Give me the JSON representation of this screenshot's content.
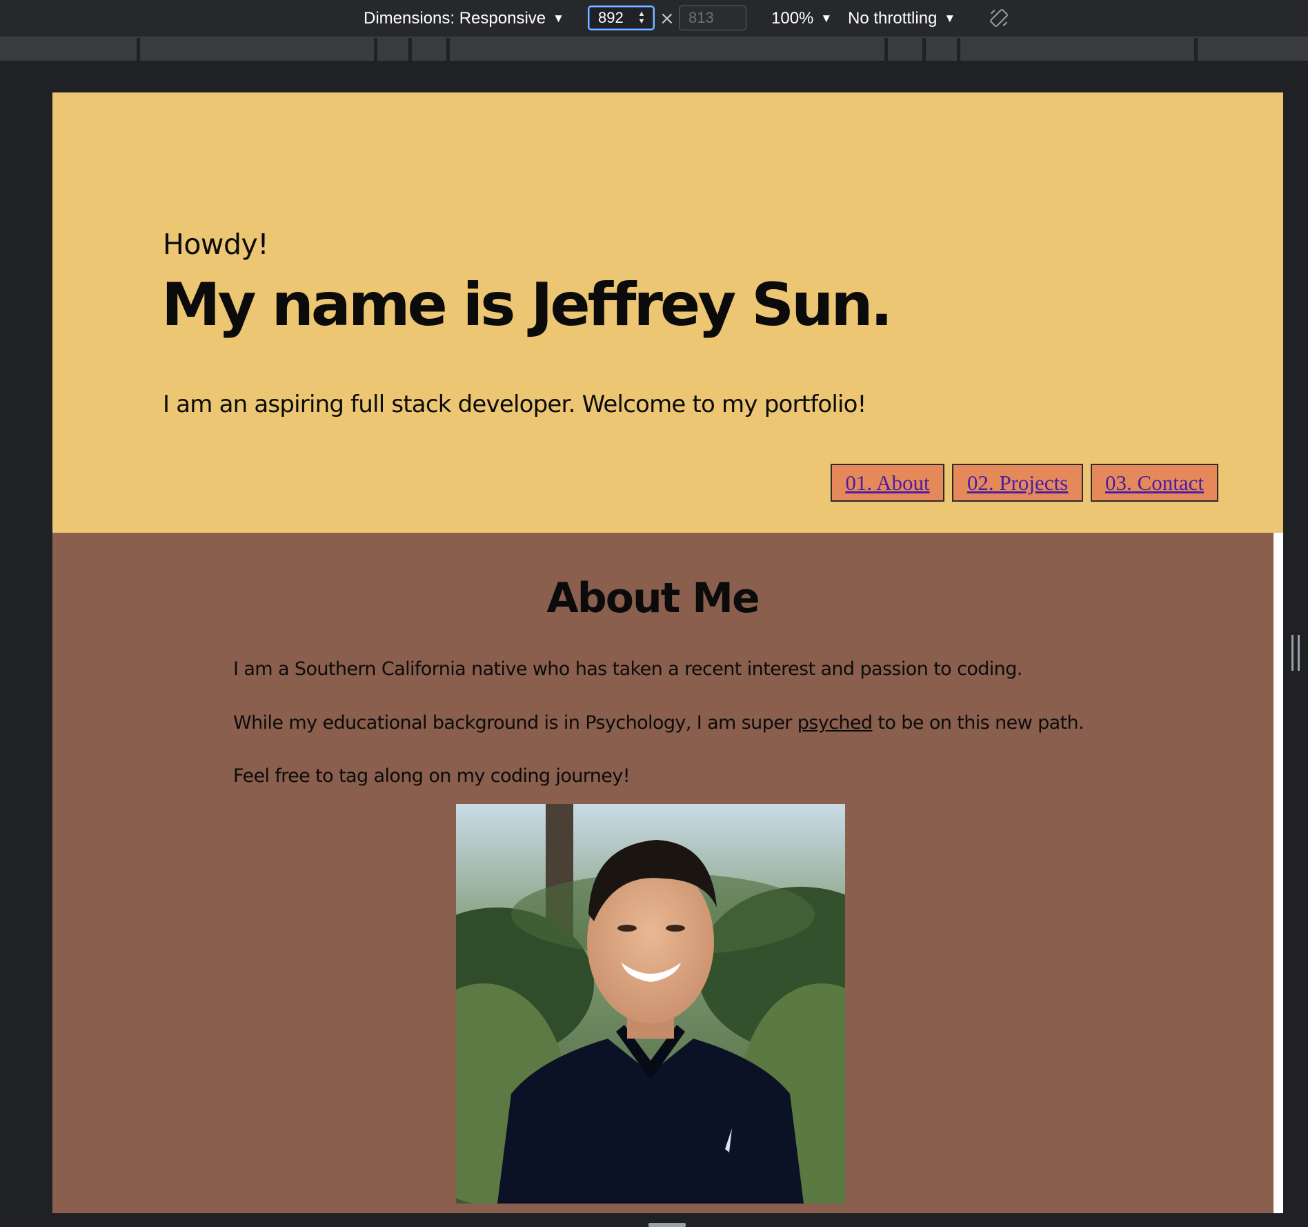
{
  "devtools": {
    "dimensions_label": "Dimensions: Responsive",
    "width_value": "892",
    "height_placeholder": "813",
    "times": "×",
    "zoom": "100%",
    "throttling": "No throttling",
    "caret": "▼",
    "stepper_up": "▲",
    "stepper_down": "▼",
    "rotate_icon": "rotate-icon"
  },
  "page": {
    "greeting": "Howdy!",
    "headline": "My name is Jeffrey Sun.",
    "tagline": "I am an aspiring full stack developer. Welcome to my portfolio!",
    "nav": [
      {
        "label": "01. About"
      },
      {
        "label": "02. Projects"
      },
      {
        "label": "03. Contact"
      }
    ],
    "about": {
      "title": "About Me",
      "p1": "I am a Southern California native who has taken a recent interest and passion to coding.",
      "p2_before": "While my educational background is in Psychology, I am super ",
      "p2_link": "psyched",
      "p2_after": " to be on this new path.",
      "p3": "Feel free to tag along on my coding journey!"
    },
    "colors": {
      "hero_bg": "#ecc672",
      "about_bg": "#8b5f4d",
      "nav_bg": "#e5895b",
      "link": "#4a1ea0"
    }
  }
}
